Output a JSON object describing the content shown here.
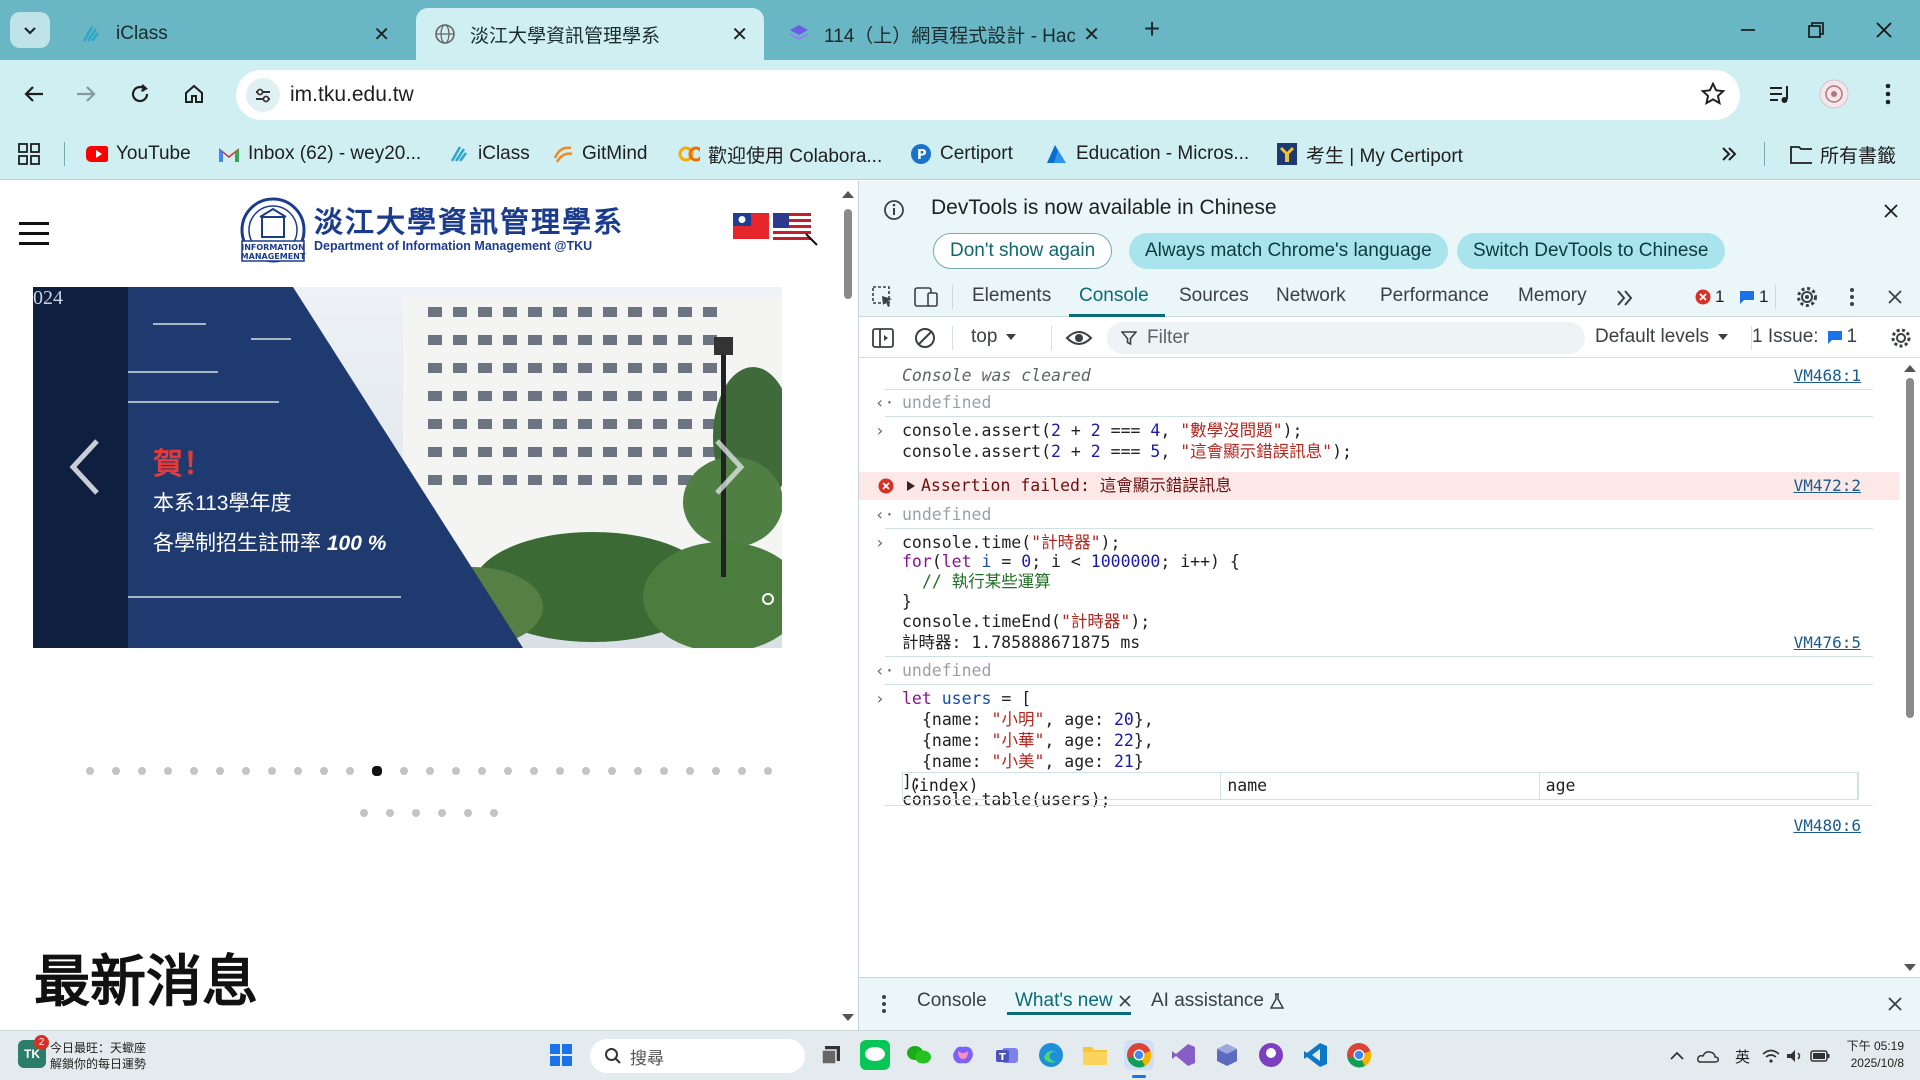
{
  "browser": {
    "tabs": [
      {
        "title": "iClass",
        "active": false
      },
      {
        "title": "淡江大學資訊管理學系",
        "active": true
      },
      {
        "title": "114（上）網頁程式設計 - Hack",
        "active": false
      }
    ],
    "url": "im.tku.edu.tw",
    "bookmarks": [
      {
        "label": "YouTube",
        "icon": "youtube-icon"
      },
      {
        "label": "Inbox (62) - wey20...",
        "icon": "gmail-icon"
      },
      {
        "label": "iClass",
        "icon": "iclass-icon"
      },
      {
        "label": "GitMind",
        "icon": "gitmind-icon"
      },
      {
        "label": "歡迎使用 Colabora...",
        "icon": "colab-icon"
      },
      {
        "label": "Certiport",
        "icon": "certiport-icon"
      },
      {
        "label": "Education - Micros...",
        "icon": "azure-icon"
      },
      {
        "label": "考生 | My Certiport",
        "icon": "certiport-exam-icon"
      }
    ],
    "all_bookmarks_label": "所有書籤"
  },
  "page": {
    "logo_cn": "淡江大學資訊管理學系",
    "logo_en": "Department of Information Management @TKU",
    "seal_text": "INFORMATION MANAGEMENT",
    "slide": {
      "corner_text": "024",
      "congrats": "賀！",
      "line1": "本系113學年度",
      "line2": "各學制招生註冊率",
      "percent": "100 %"
    },
    "carousel_dot_count": 33,
    "carousel_active_dot_index": 11,
    "news_heading": "最新消息"
  },
  "devtools": {
    "infobar": {
      "message": "DevTools is now available in Chinese",
      "btn_dont_show": "Don't show again",
      "btn_always_match": "Always match Chrome's language",
      "btn_switch": "Switch DevTools to Chinese"
    },
    "tabs": [
      "Elements",
      "Console",
      "Sources",
      "Network",
      "Performance",
      "Memory"
    ],
    "active_tab": "Console",
    "error_count": "1",
    "message_count": "1",
    "filter": {
      "context": "top",
      "placeholder": "Filter",
      "levels": "Default levels",
      "issues_label": "1 Issue:",
      "issues_count": "1"
    },
    "console": {
      "cleared": "Console was cleared",
      "cleared_src": "VM468:1",
      "undefined": "undefined",
      "assert_line1_pre": "console.assert(",
      "assert_line2_pre": "console.assert(",
      "assert_str1": "\"數學沒問題\"",
      "assert_str2": "\"這會顯示錯誤訊息\"",
      "assert_error": "Assertion failed: 這會顯示錯誤訊息",
      "assert_src": "VM472:2",
      "timer_str": "\"計時器\"",
      "loop_count": "1000000",
      "loop_comment": "// 執行某些運算",
      "timer_output": "計時器: 1.785888671875 ms",
      "timer_src": "VM476:5",
      "users": [
        {
          "name": "\"小明\"",
          "age": "20"
        },
        {
          "name": "\"小華\"",
          "age": "22"
        },
        {
          "name": "\"小美\"",
          "age": "21"
        }
      ],
      "table_src": "VM480:6",
      "table_headers": [
        "(index)",
        "name",
        "age"
      ]
    },
    "drawer": {
      "tabs": [
        "Console",
        "What's new",
        "AI assistance"
      ],
      "active": "What's new"
    }
  },
  "taskbar": {
    "weather_line1": "今日最旺：天蠍座",
    "weather_line2": "解鎖你的每日運勢",
    "notification_badge": "2",
    "search_placeholder": "搜尋",
    "ime": "英",
    "time": "下午 05:19",
    "date": "2025/10/8"
  }
}
